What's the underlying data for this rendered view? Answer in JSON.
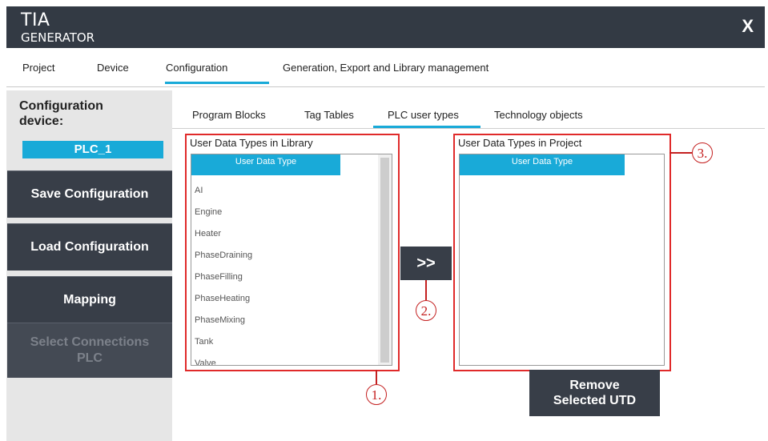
{
  "app": {
    "title_main": "TIA",
    "title_sub": "GENERATOR",
    "close_label": "X"
  },
  "main_tabs": [
    "Project",
    "Device",
    "Configuration",
    "Generation, Export and Library management"
  ],
  "sidebar": {
    "config_label_line1": "Configuration",
    "config_label_line2": "device:",
    "device_name": "PLC_1",
    "buttons": [
      "Save Configuration",
      "Load Configuration",
      "Mapping"
    ],
    "disabled_button_line1": "Select Connections",
    "disabled_button_line2": "PLC"
  },
  "sub_tabs": [
    "Program Blocks",
    "Tag Tables",
    "PLC user types",
    "Technology objects"
  ],
  "library_panel": {
    "title": "User Data Types in Library",
    "header": "User Data Type",
    "items": [
      "AI",
      "Engine",
      "Heater",
      "PhaseDraining",
      "PhaseFilling",
      "PhaseHeating",
      "PhaseMixing",
      "Tank",
      "Valve"
    ]
  },
  "project_panel": {
    "title": "User Data Types in Project",
    "header": "User Data Type"
  },
  "transfer_button": ">>",
  "remove_button": {
    "line1": "Remove",
    "line2": "Selected UTD"
  },
  "callouts": [
    "1.",
    "2.",
    "3."
  ]
}
